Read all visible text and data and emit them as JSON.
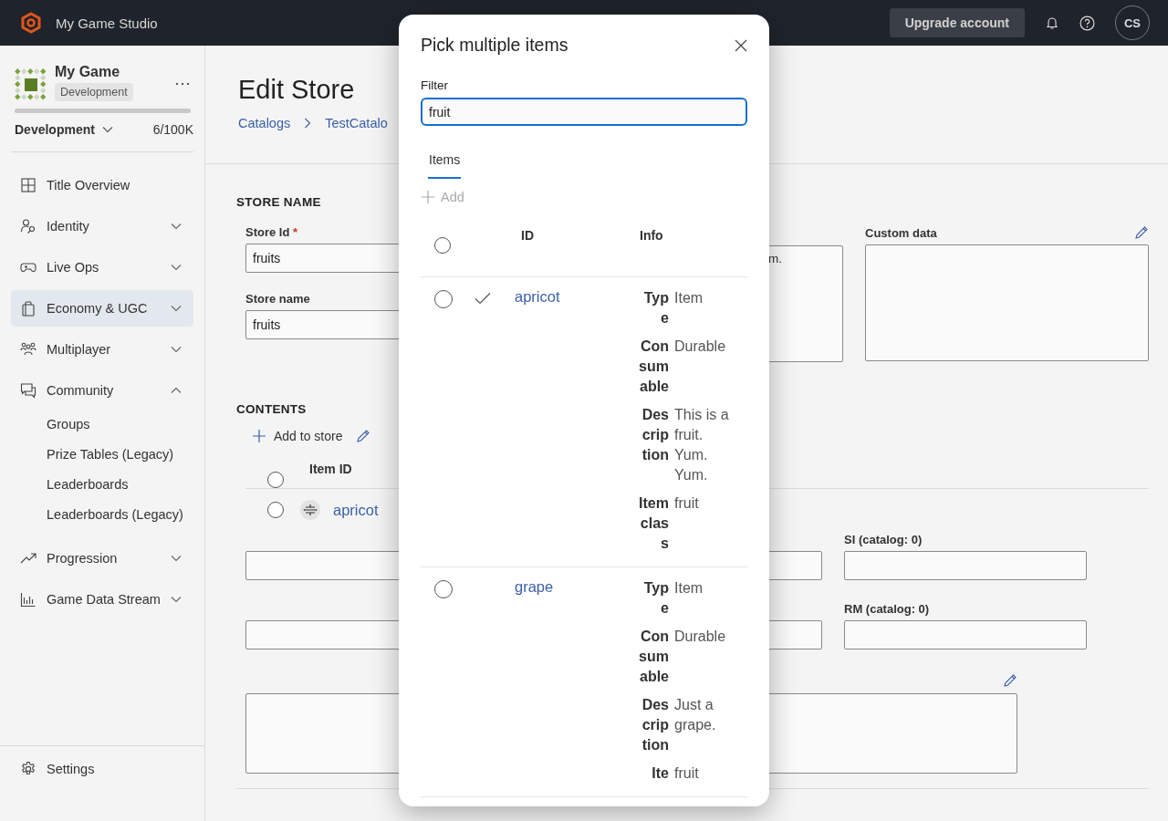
{
  "top_bar": {
    "app_name": "My Game Studio",
    "upgrade_button": "Upgrade account",
    "avatar": "CS"
  },
  "sidebar": {
    "game_name": "My Game",
    "game_badge": "Development",
    "environment": "Development",
    "usage": "6/100K",
    "nav": [
      {
        "label": "Title Overview",
        "kind": "link",
        "selected": false
      },
      {
        "label": "Identity",
        "kind": "group",
        "expanded": false,
        "selected": false
      },
      {
        "label": "Live Ops",
        "kind": "group",
        "expanded": false,
        "selected": false
      },
      {
        "label": "Economy & UGC",
        "kind": "group",
        "expanded": false,
        "selected": true
      },
      {
        "label": "Multiplayer",
        "kind": "group",
        "expanded": false,
        "selected": false
      },
      {
        "label": "Community",
        "kind": "group",
        "expanded": true,
        "selected": false,
        "children": [
          {
            "label": "Groups"
          },
          {
            "label": "Prize Tables (Legacy)"
          },
          {
            "label": "Leaderboards"
          },
          {
            "label": "Leaderboards (Legacy)"
          }
        ]
      },
      {
        "label": "Progression",
        "kind": "group",
        "expanded": false,
        "selected": false
      },
      {
        "label": "Game Data Stream",
        "kind": "group",
        "expanded": false,
        "selected": false
      }
    ],
    "settings": "Settings"
  },
  "page": {
    "title": "Edit Store",
    "breadcrumbs": [
      "Catalogs",
      "TestCatalo"
    ],
    "store_name_section": {
      "heading": "STORE NAME",
      "store_id": {
        "label": "Store Id",
        "required_mark": "*",
        "value": "fruits"
      },
      "store_name": {
        "label": "Store name",
        "value": "fruits"
      },
      "description_value": "m.",
      "custom_data": {
        "label": "Custom data"
      }
    },
    "contents_section": {
      "heading": "CONTENTS",
      "add_button": "Add to store",
      "column": "Item ID",
      "all_selected": false,
      "rows": [
        {
          "id": "apricot",
          "selected": false
        }
      ],
      "detail": {
        "si_label": "SI (catalog: 0)",
        "rm_label": "RM (catalog: 0)"
      }
    }
  },
  "dialog": {
    "title": "Pick multiple items",
    "filter": {
      "label": "Filter",
      "value": "fruit"
    },
    "tabs": [
      {
        "label": "Items",
        "selected": true
      }
    ],
    "add_button": {
      "label": "Add",
      "disabled": true
    },
    "columns": [
      "ID",
      "Info"
    ],
    "all_selected": false,
    "rows": [
      {
        "id": "apricot",
        "selected": false,
        "in_store": true,
        "info": [
          {
            "label": "Type",
            "value": "Item"
          },
          {
            "label": "Consumable",
            "value": "Durable"
          },
          {
            "label": "Description",
            "value": "This is a fruit. Yum. Yum."
          },
          {
            "label": "Item class",
            "value": "fruit"
          }
        ]
      },
      {
        "id": "grape",
        "selected": false,
        "in_store": false,
        "info": [
          {
            "label": "Type",
            "value": "Item"
          },
          {
            "label": "Consumable",
            "value": "Durable"
          },
          {
            "label": "Description",
            "value": "Just a grape."
          },
          {
            "label": "Ite",
            "value": "fruit"
          }
        ]
      }
    ]
  }
}
